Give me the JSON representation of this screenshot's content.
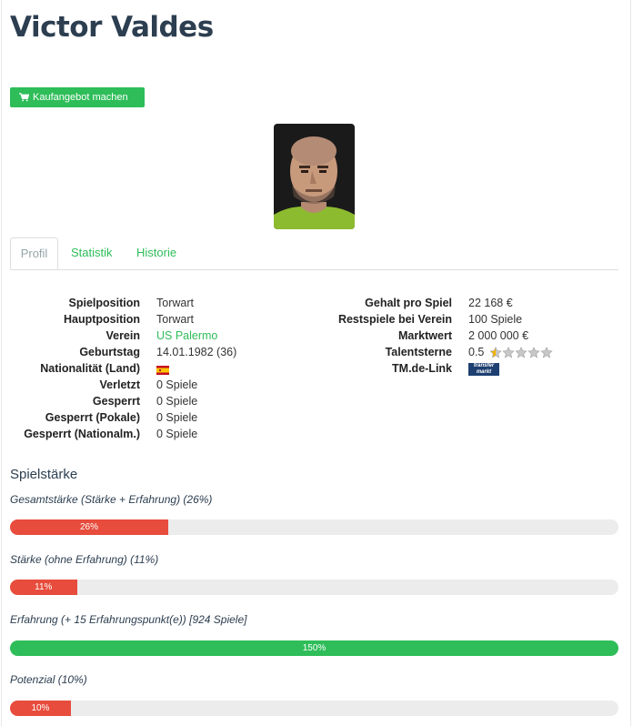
{
  "title": "Victor Valdes",
  "buy_button": {
    "label": "Kaufangebot machen",
    "icon": "shopping-cart-icon"
  },
  "photo": {
    "icon": "player-portrait"
  },
  "tabs": [
    {
      "label": "Profil",
      "active": true
    },
    {
      "label": "Statistik",
      "active": false
    },
    {
      "label": "Historie",
      "active": false
    }
  ],
  "profile_left": [
    {
      "label": "Spielposition",
      "value": "Torwart"
    },
    {
      "label": "Hauptposition",
      "value": "Torwart"
    },
    {
      "label": "Verein",
      "value": "US Palermo"
    },
    {
      "label": "Geburtstag",
      "value": "14.01.1982 (36)"
    },
    {
      "label": "Nationalität (Land)",
      "value": "",
      "icon": "spain-flag-icon"
    },
    {
      "label": "Verletzt",
      "value": "0 Spiele"
    },
    {
      "label": "Gesperrt",
      "value": "0 Spiele"
    },
    {
      "label": "Gesperrt (Pokale)",
      "value": "0 Spiele"
    },
    {
      "label": "Gesperrt (Nationalm.)",
      "value": "0 Spiele"
    }
  ],
  "profile_right": [
    {
      "label": "Gehalt pro Spiel",
      "value": "22 168 €"
    },
    {
      "label": "Restspiele bei Verein",
      "value": "100 Spiele"
    },
    {
      "label": "Marktwert",
      "value": "2 000 000 €"
    },
    {
      "label": "Talentsterne",
      "value": "0.5",
      "stars": 0.5,
      "stars_max": 5
    },
    {
      "label": "TM.de-Link",
      "value": "",
      "badge_lines": [
        "transfer",
        "markt"
      ]
    }
  ],
  "skills": {
    "heading": "Spielstärke",
    "bars": [
      {
        "label": "Gesamtstärke (Stärke + Erfahrung) (26%)",
        "text": "26%",
        "percent": 26,
        "color": "#e74c3c"
      },
      {
        "label": "Stärke (ohne Erfahrung) (11%)",
        "text": "11%",
        "percent": 11,
        "color": "#e74c3c"
      },
      {
        "label": "Erfahrung (+ 15 Erfahrungspunkt(e)) [924 Spiele]",
        "text": "150%",
        "percent": 100,
        "color": "#2ebd59"
      },
      {
        "label": "Potenzial (10%)",
        "text": "10%",
        "percent": 10,
        "color": "#e74c3c"
      }
    ]
  },
  "colors": {
    "accent": "#2ebd59",
    "danger": "#e74c3c",
    "text": "#2c3e50"
  }
}
